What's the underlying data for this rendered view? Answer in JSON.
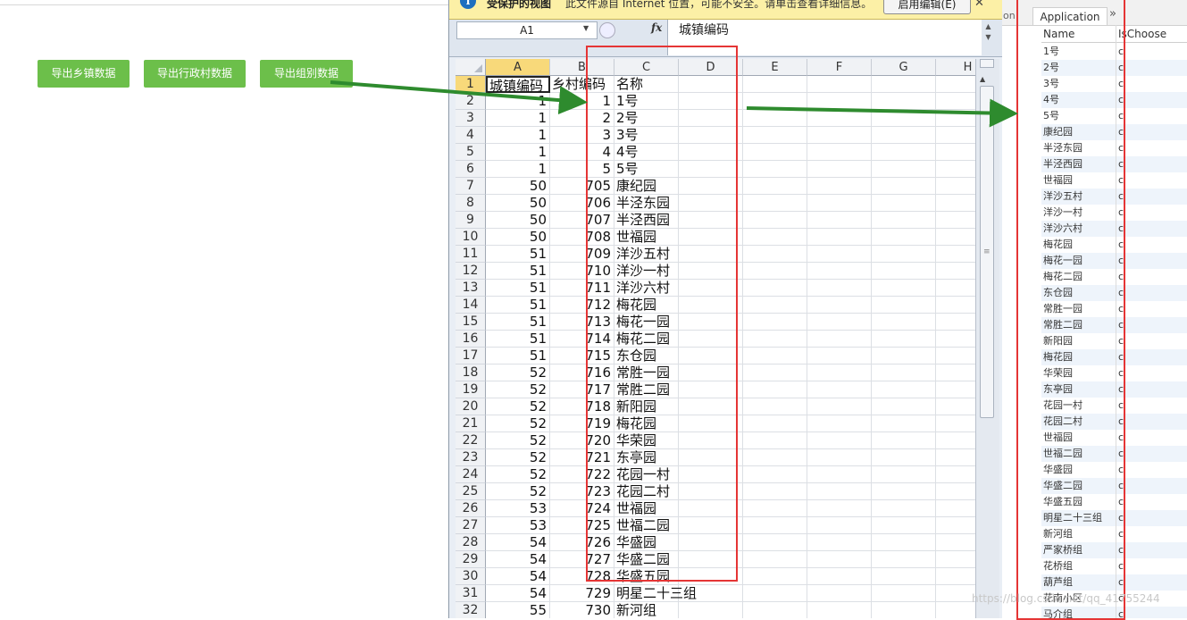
{
  "buttons": {
    "export_town": "导出乡镇数据",
    "export_village": "导出行政村数据",
    "export_group": "导出组别数据"
  },
  "protected_view": {
    "title": "受保护的视图",
    "message": "此文件源自 Internet 位置，可能不安全。请单击查看详细信息。",
    "enable_button": "启用编辑(E)",
    "close": "✕"
  },
  "formula_bar": {
    "name_box": "A1",
    "fx": "fx",
    "value": "城镇编码"
  },
  "columns": [
    "A",
    "B",
    "C",
    "D",
    "E",
    "F",
    "G",
    "H"
  ],
  "rows": [
    {
      "r": "1",
      "a": "城镇编码",
      "b": "乡村编码",
      "c": "名称"
    },
    {
      "r": "2",
      "a": "1",
      "b": "1",
      "c": "1号"
    },
    {
      "r": "3",
      "a": "1",
      "b": "2",
      "c": "2号"
    },
    {
      "r": "4",
      "a": "1",
      "b": "3",
      "c": "3号"
    },
    {
      "r": "5",
      "a": "1",
      "b": "4",
      "c": "4号"
    },
    {
      "r": "6",
      "a": "1",
      "b": "5",
      "c": "5号"
    },
    {
      "r": "7",
      "a": "50",
      "b": "705",
      "c": "康纪园"
    },
    {
      "r": "8",
      "a": "50",
      "b": "706",
      "c": "半泾东园"
    },
    {
      "r": "9",
      "a": "50",
      "b": "707",
      "c": "半泾西园"
    },
    {
      "r": "10",
      "a": "50",
      "b": "708",
      "c": "世福园"
    },
    {
      "r": "11",
      "a": "51",
      "b": "709",
      "c": "洋沙五村"
    },
    {
      "r": "12",
      "a": "51",
      "b": "710",
      "c": "洋沙一村"
    },
    {
      "r": "13",
      "a": "51",
      "b": "711",
      "c": "洋沙六村"
    },
    {
      "r": "14",
      "a": "51",
      "b": "712",
      "c": "梅花园"
    },
    {
      "r": "15",
      "a": "51",
      "b": "713",
      "c": "梅花一园"
    },
    {
      "r": "16",
      "a": "51",
      "b": "714",
      "c": "梅花二园"
    },
    {
      "r": "17",
      "a": "51",
      "b": "715",
      "c": "东仓园"
    },
    {
      "r": "18",
      "a": "52",
      "b": "716",
      "c": "常胜一园"
    },
    {
      "r": "19",
      "a": "52",
      "b": "717",
      "c": "常胜二园"
    },
    {
      "r": "20",
      "a": "52",
      "b": "718",
      "c": "新阳园"
    },
    {
      "r": "21",
      "a": "52",
      "b": "719",
      "c": "梅花园"
    },
    {
      "r": "22",
      "a": "52",
      "b": "720",
      "c": "华荣园"
    },
    {
      "r": "23",
      "a": "52",
      "b": "721",
      "c": "东亭园"
    },
    {
      "r": "24",
      "a": "52",
      "b": "722",
      "c": "花园一村"
    },
    {
      "r": "25",
      "a": "52",
      "b": "723",
      "c": "花园二村"
    },
    {
      "r": "26",
      "a": "53",
      "b": "724",
      "c": "世福园"
    },
    {
      "r": "27",
      "a": "53",
      "b": "725",
      "c": "世福二园"
    },
    {
      "r": "28",
      "a": "54",
      "b": "726",
      "c": "华盛园"
    },
    {
      "r": "29",
      "a": "54",
      "b": "727",
      "c": "华盛二园"
    },
    {
      "r": "30",
      "a": "54",
      "b": "728",
      "c": "华盛五园"
    },
    {
      "r": "31",
      "a": "54",
      "b": "729",
      "c": "明星二十三组"
    },
    {
      "r": "32",
      "a": "55",
      "b": "730",
      "c": "新河组"
    }
  ],
  "right_panel": {
    "tab_prev": "ion",
    "tab": "Application",
    "more": "»",
    "col_name": "Name",
    "col_choose": "IsChoose",
    "items": [
      "1号",
      "2号",
      "3号",
      "4号",
      "5号",
      "康纪园",
      "半泾东园",
      "半泾西园",
      "世福园",
      "洋沙五村",
      "洋沙一村",
      "洋沙六村",
      "梅花园",
      "梅花一园",
      "梅花二园",
      "东仓园",
      "常胜一园",
      "常胜二园",
      "新阳园",
      "梅花园",
      "华荣园",
      "东亭园",
      "花园一村",
      "花园二村",
      "世福园",
      "世福二园",
      "华盛园",
      "华盛二园",
      "华盛五园",
      "明星二十三组",
      "新河组",
      "严家桥组",
      "花桥组",
      "葫芦组",
      "花南小区",
      "马介组"
    ],
    "choose_value": "c"
  },
  "watermark": "https://blog.csdn.net/qq_41755244"
}
